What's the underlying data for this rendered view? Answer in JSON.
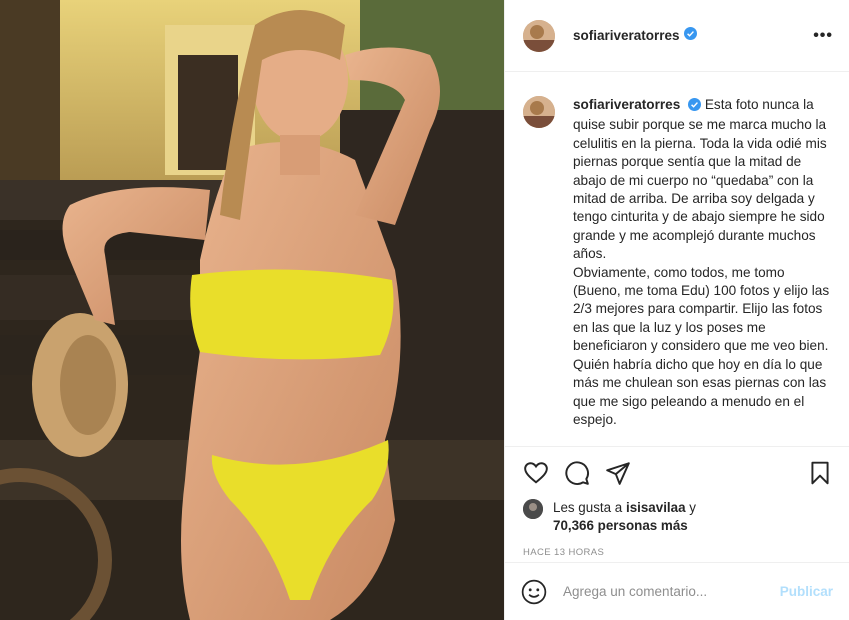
{
  "author": {
    "username": "sofiariveratorres",
    "verified": true
  },
  "header": {
    "more_label": "•••"
  },
  "caption": {
    "username": "sofiariveratorres",
    "text": "Esta foto nunca la quise subir porque se me marca mucho la celulitis en la pierna. Toda la vida odié mis piernas porque sentía que la mitad de abajo de mi cuerpo no “quedaba” con la mitad de arriba. De arriba soy delgada y tengo cinturita y de abajo siempre he sido grande y me acomplejó durante muchos años.\nObviamente, como todos, me tomo (Bueno, me toma Edu) 100 fotos y elijo las 2/3 mejores para compartir. Elijo las fotos en las que la luz y los poses me beneficiaron y considero que me veo bien. Quién habría dicho que hoy en día lo que más me chulean son esas piernas con las que me sigo peleando a menudo en el espejo."
  },
  "actions": {
    "like_icon": "heart-icon",
    "comment_icon": "comment-icon",
    "share_icon": "send-icon",
    "save_icon": "bookmark-icon"
  },
  "likes": {
    "prefix": "Les gusta a ",
    "user": "isisavilaa",
    "middle": " y",
    "count": "70,366 personas más"
  },
  "timestamp": "HACE 13 HORAS",
  "comment_box": {
    "placeholder": "Agrega un comentario...",
    "publish_label": "Publicar",
    "emoji_icon": "emoji-icon"
  },
  "colors": {
    "bikini": "#e9de2a",
    "verified": "#3897f0",
    "publish": "#b2dffc"
  }
}
